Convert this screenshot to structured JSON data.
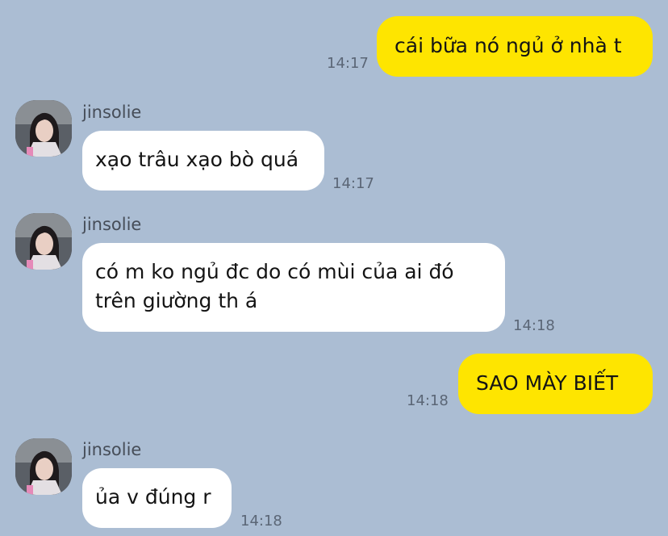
{
  "messages": [
    {
      "side": "out",
      "text": "cái bữa nó ngủ ở nhà t",
      "time": "14:17"
    },
    {
      "side": "in",
      "sender": "jinsolie",
      "text": "xạo trâu xạo bò quá",
      "time": "14:17"
    },
    {
      "side": "in",
      "sender": "jinsolie",
      "text_line1": "có m ko ngủ đc do có mùi của ai đó",
      "text_line2": "trên giường th á",
      "time": "14:18"
    },
    {
      "side": "out",
      "text": "SAO MÀY BIẾT",
      "time": "14:18"
    },
    {
      "side": "in",
      "sender": "jinsolie",
      "text": "ủa v đúng r",
      "time": "14:18"
    }
  ],
  "colors": {
    "background": "#abbdd3",
    "outgoing_bubble": "#fee500",
    "incoming_bubble": "#ffffff"
  },
  "icons": {
    "avatar": "profile-photo"
  }
}
